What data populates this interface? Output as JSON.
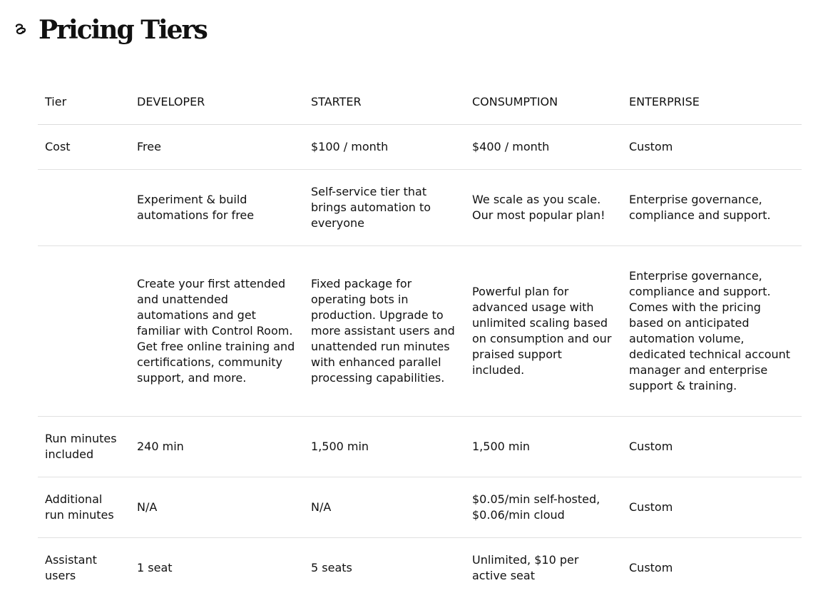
{
  "page": {
    "title": "Pricing Tiers",
    "logo_icon": "link-loop-icon"
  },
  "table": {
    "header": {
      "label": "Tier",
      "tiers": [
        "DEVELOPER",
        "STARTER",
        "CONSUMPTION",
        "ENTERPRISE"
      ]
    },
    "rows": [
      {
        "label": "Cost",
        "values": [
          "Free",
          "$100 / month",
          "$400 / month",
          "Custom"
        ]
      },
      {
        "label": "",
        "values": [
          "Experiment & build automations for free",
          "Self-service tier that brings automation to everyone",
          "We scale as you scale. Our most popular plan!",
          "Enterprise governance, compliance and support."
        ]
      },
      {
        "label": "",
        "values": [
          "Create your first attended and unattended automations and get familiar with Control Room. Get free online training and certifications, community support, and more.",
          "Fixed package for operating bots in production. Upgrade to more assistant users and unattended run minutes with enhanced parallel processing capabilities.",
          "Powerful plan for advanced usage with unlimited scaling based on consumption and our praised support included.",
          "Enterprise governance, compliance and support. Comes with the pricing based on anticipated automation volume, dedicated technical account manager and enterprise support & training."
        ]
      },
      {
        "label": "Run minutes included",
        "values": [
          "240 min",
          "1,500 min",
          "1,500 min",
          "Custom"
        ]
      },
      {
        "label": "Additional run minutes",
        "values": [
          "N/A",
          "N/A",
          "$0.05/min self-hosted, $0.06/min cloud",
          "Custom"
        ]
      },
      {
        "label": "Assistant users",
        "values": [
          "1 seat",
          "5 seats",
          "Unlimited, $10 per active seat",
          "Custom"
        ]
      }
    ]
  }
}
